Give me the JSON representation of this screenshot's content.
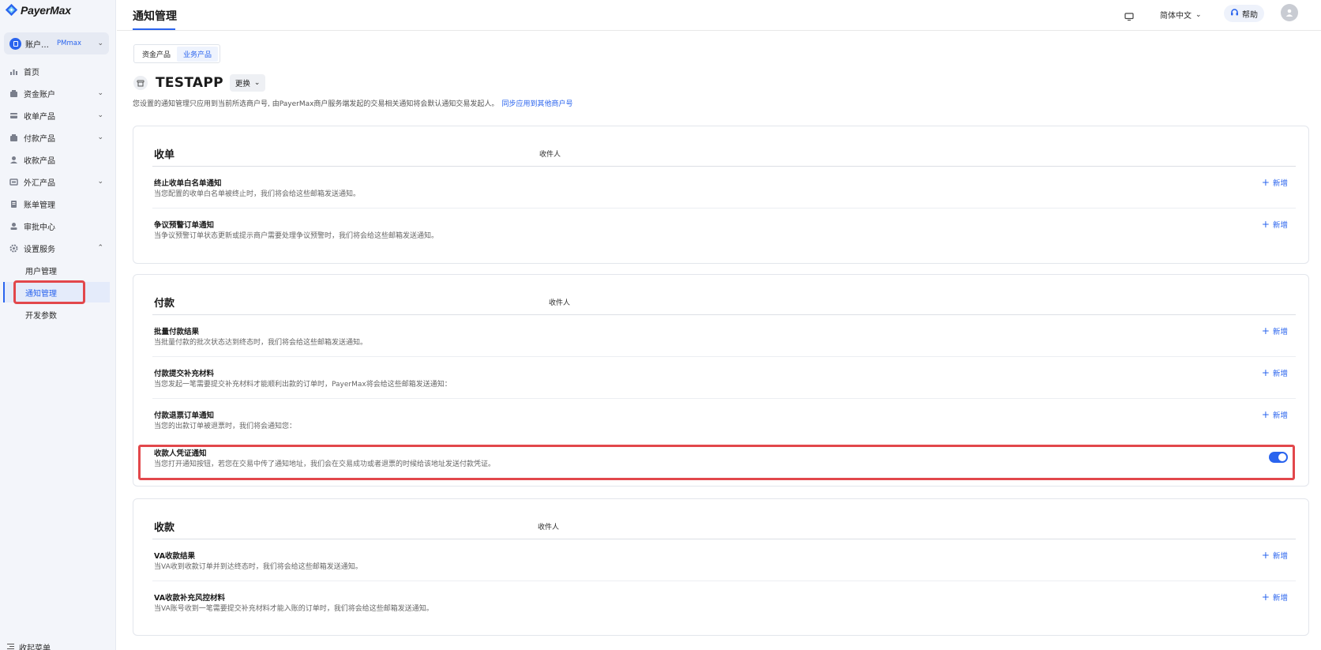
{
  "brand": {
    "name": "PayerMax",
    "primary_color": "#2a64ee",
    "highlight_color": "#e2474b"
  },
  "account": {
    "name": "账户…",
    "badge": "PMmax"
  },
  "sidebar": {
    "items": [
      {
        "label": "首页",
        "icon": "chart-icon"
      },
      {
        "label": "资金账户",
        "icon": "wallet-icon",
        "expand": true
      },
      {
        "label": "收单产品",
        "icon": "card-icon",
        "expand": true
      },
      {
        "label": "付款产品",
        "icon": "wallet-icon",
        "expand": true
      },
      {
        "label": "收款产品",
        "icon": "person-icon"
      },
      {
        "label": "外汇产品",
        "icon": "exchange-icon",
        "expand": true
      },
      {
        "label": "账单管理",
        "icon": "bill-icon"
      },
      {
        "label": "审批中心",
        "icon": "approve-icon"
      },
      {
        "label": "设置服务",
        "icon": "gear-icon",
        "expanded": true
      }
    ],
    "sub_items": [
      {
        "label": "用户管理"
      },
      {
        "label": "通知管理",
        "active": true
      },
      {
        "label": "开发参数"
      }
    ],
    "collapse_label": "收起菜单"
  },
  "header": {
    "title": "通知管理",
    "language": "简体中文",
    "help": "帮助"
  },
  "tabs": [
    {
      "label": "资金产品"
    },
    {
      "label": "业务产品",
      "active": true
    }
  ],
  "app": {
    "name": "TESTAPP",
    "switch_label": "更换"
  },
  "intro": {
    "text": "您设置的通知管理只应用到当前所选商户号, 由PayerMax商户服务端发起的交易相关通知将会默认通知交易发起人。",
    "link": "同步应用到其他商户号"
  },
  "sections": [
    {
      "title": "收单",
      "recipient_label": "收件人",
      "rows": [
        {
          "title": "终止收单白名单通知",
          "desc": "当您配置的收单白名单被终止时，我们将会给这些邮箱发送通知。",
          "action": "新增"
        },
        {
          "title": "争议预警订单通知",
          "desc": "当争议预警订单状态更新或提示商户需要处理争议预警时，我们将会给这些邮箱发送通知。",
          "action": "新增"
        }
      ]
    },
    {
      "title": "付款",
      "recipient_label": "收件人",
      "rows": [
        {
          "title": "批量付款结果",
          "desc": "当批量付款的批次状态达到终态时，我们将会给这些邮箱发送通知。",
          "action": "新增"
        },
        {
          "title": "付款提交补充材料",
          "desc": "当您发起一笔需要提交补充材料才能顺利出款的订单时，PayerMax将会给这些邮箱发送通知：",
          "action": "新增"
        },
        {
          "title": "付款退票订单通知",
          "desc": "当您的出款订单被退票时，我们将会通知您：",
          "action": "新增"
        },
        {
          "title": "收款人凭证通知",
          "desc": "当您打开通知按钮，若您在交易中传了通知地址，我们会在交易成功或者退票的时候给该地址发送付款凭证。",
          "toggle": true,
          "toggle_on": true
        }
      ]
    },
    {
      "title": "收款",
      "recipient_label": "收件人",
      "rows": [
        {
          "title": "VA收款结果",
          "desc": "当VA收到收款订单并到达终态时，我们将会给这些邮箱发送通知。",
          "action": "新增"
        },
        {
          "title": "VA收款补充风控材料",
          "desc": "当VA账号收到一笔需要提交补充材料才能入账的订单时，我们将会给这些邮箱发送通知。",
          "action": "新增"
        }
      ]
    }
  ]
}
